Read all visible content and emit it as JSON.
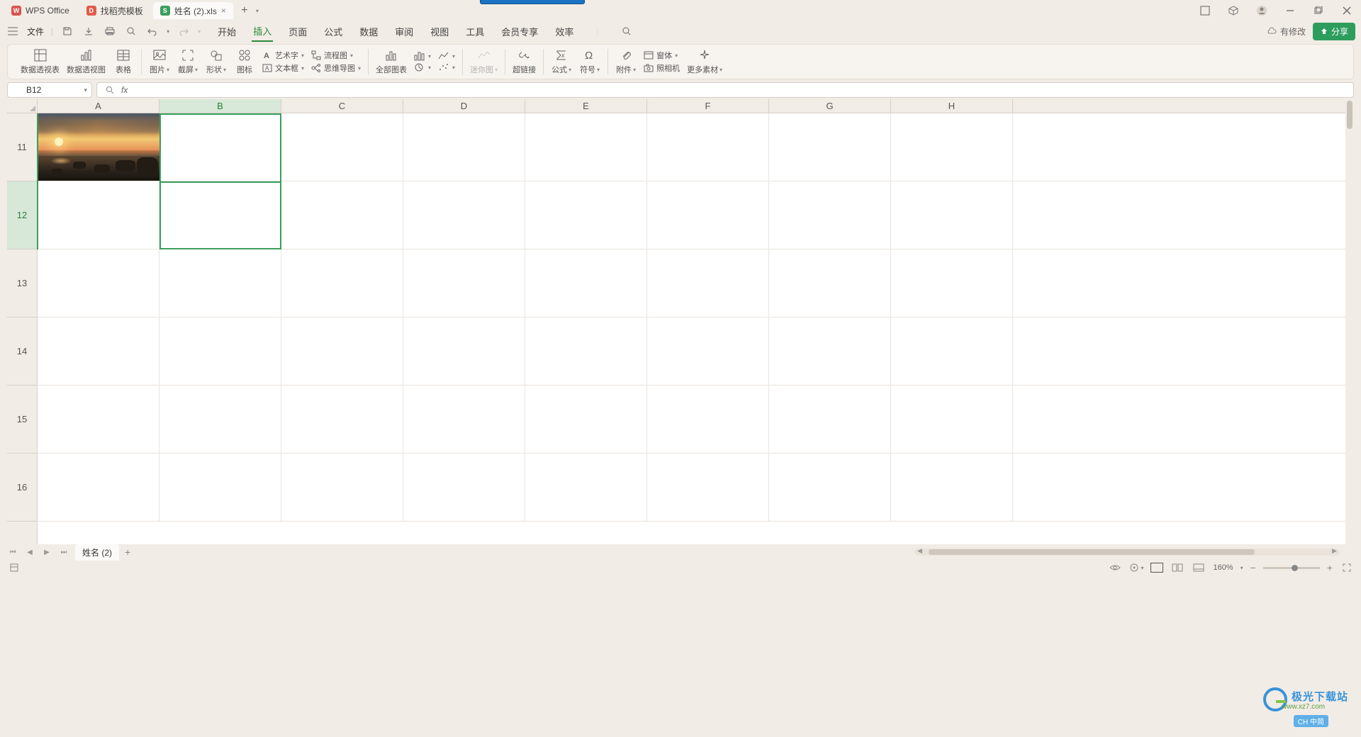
{
  "titlebar": {
    "tabs": [
      {
        "icon": "W",
        "label": "WPS Office"
      },
      {
        "icon": "D",
        "label": "找稻壳模板"
      },
      {
        "icon": "S",
        "label": "姓名 (2).xls"
      }
    ],
    "add": "+"
  },
  "menu": {
    "file": "文件",
    "tabs": [
      "开始",
      "插入",
      "页面",
      "公式",
      "数据",
      "审阅",
      "视图",
      "工具",
      "会员专享",
      "效率"
    ],
    "active_index": 1,
    "cloud_status": "有修改",
    "share": "分享"
  },
  "ribbon": {
    "g1": {
      "pivot_table": "数据透视表",
      "pivot_chart": "数据透视图",
      "table": "表格"
    },
    "g2": {
      "picture": "图片",
      "screenshot": "截屏",
      "shapes": "形状",
      "icons": "图标"
    },
    "g2b": {
      "wordart": "艺术字",
      "flowchart": "流程图",
      "textbox": "文本框",
      "mindmap": "思维导图"
    },
    "g3": {
      "all_charts": "全部图表"
    },
    "g4": {
      "mini_chart": "迷你图"
    },
    "g5": {
      "hyperlink": "超链接"
    },
    "g6": {
      "formula": "公式",
      "symbol": "符号"
    },
    "g7": {
      "attachment": "附件",
      "object": "窗体",
      "camera": "照相机",
      "more": "更多素材"
    }
  },
  "namebox": {
    "value": "B12"
  },
  "formula": {
    "fx": "fx",
    "value": ""
  },
  "columns": [
    "A",
    "B",
    "C",
    "D",
    "E",
    "F",
    "G",
    "H"
  ],
  "rows": [
    "11",
    "12",
    "13",
    "14",
    "15",
    "16"
  ],
  "selected_col_index": 1,
  "selected_row_index": 1,
  "sheet_tabs": {
    "active": "姓名 (2)"
  },
  "statusbar": {
    "zoom": "160%"
  },
  "watermark": {
    "text": "极光下载站",
    "sub": "www.xz7.com"
  },
  "ime": "CH 中简"
}
